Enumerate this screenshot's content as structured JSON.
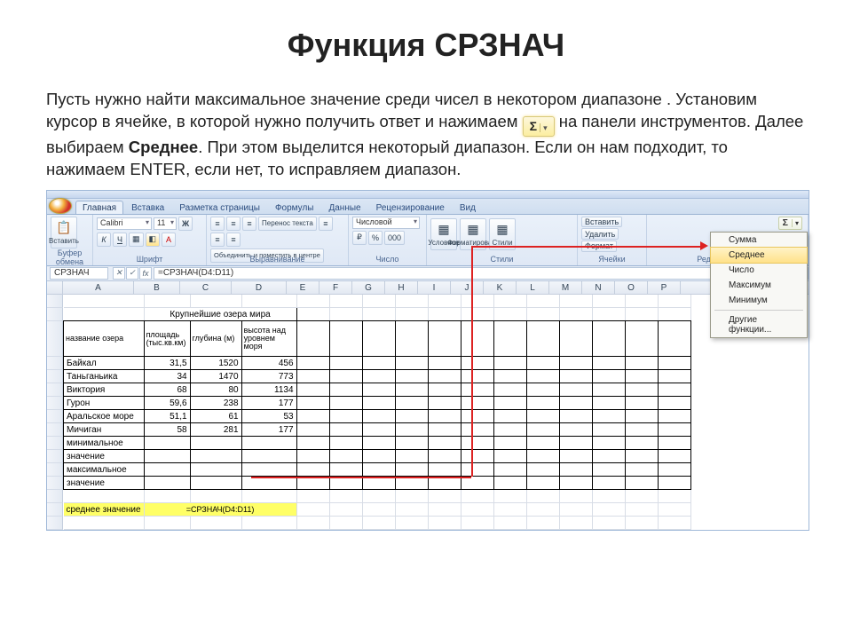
{
  "title": "Функция СРЗНАЧ",
  "desc": {
    "p1a": "Пусть нужно найти максимальное значение среди чисел в некотором диапазоне . Установим курсор в ячейке, в которой нужно получить ответ  и нажимаем ",
    "p1b": "на панели инструментов. Далее выбираем ",
    "bold": "Среднее",
    "p1c": ". При этом выделится некоторый диапазон. Если он нам подходит, то  нажимаем ENTER, если нет, то исправляем диапазон."
  },
  "ribbon": {
    "tabs": [
      "Главная",
      "Вставка",
      "Разметка страницы",
      "Формулы",
      "Данные",
      "Рецензирование",
      "Вид"
    ],
    "active": 0,
    "groups": {
      "clipboard": "Буфер обмена",
      "font": "Шрифт",
      "alignment": "Выравнивание",
      "number": "Число",
      "styles": "Стили",
      "cells": "Ячейки",
      "editing": "Редактирование"
    },
    "font_name": "Calibri",
    "font_size": "11",
    "number_format": "Числовой",
    "wrap": "Перенос текста",
    "merge": "Объединить и поместить в центре",
    "paste": "Вставить",
    "styles_btns": [
      "Условное",
      "Форматировать",
      "Стили"
    ],
    "cells_btns": [
      "Вставить",
      "Удалить",
      "Формат"
    ]
  },
  "autosum_menu": [
    "Сумма",
    "Среднее",
    "Число",
    "Максимум",
    "Минимум",
    "Другие функции..."
  ],
  "formula_bar": {
    "name": "СРЗНАЧ",
    "formula": "=СРЗНАЧ(D4:D11)"
  },
  "columns": [
    "A",
    "B",
    "C",
    "D",
    "E",
    "F",
    "G",
    "H",
    "I",
    "J",
    "K",
    "L",
    "M",
    "N",
    "O",
    "P"
  ],
  "sheet": {
    "title_row": "Крупнейшие озера мира",
    "headers": [
      "название озера",
      "площадь (тыс.кв.км)",
      "глубина (м)",
      "высота над уровнем моря"
    ],
    "rows": [
      [
        "Байкал",
        "31,5",
        "1520",
        "456"
      ],
      [
        "Таньганьика",
        "34",
        "1470",
        "773"
      ],
      [
        "Виктория",
        "68",
        "80",
        "1134"
      ],
      [
        "Гурон",
        "59,6",
        "238",
        "177"
      ],
      [
        "Аральское море",
        "51,1",
        "61",
        "53"
      ],
      [
        "Мичиган",
        "58",
        "281",
        "177"
      ]
    ],
    "extra": [
      "минимальное",
      "значение",
      "максимальное",
      "значение"
    ],
    "result_label": "среднее значение",
    "result_formula": "=СРЗНАЧ(D4:D11)"
  },
  "icons": {
    "sigma": "Σ",
    "down": "▾",
    "fx": "fx",
    "cancel": "✕",
    "ok": "✓"
  }
}
